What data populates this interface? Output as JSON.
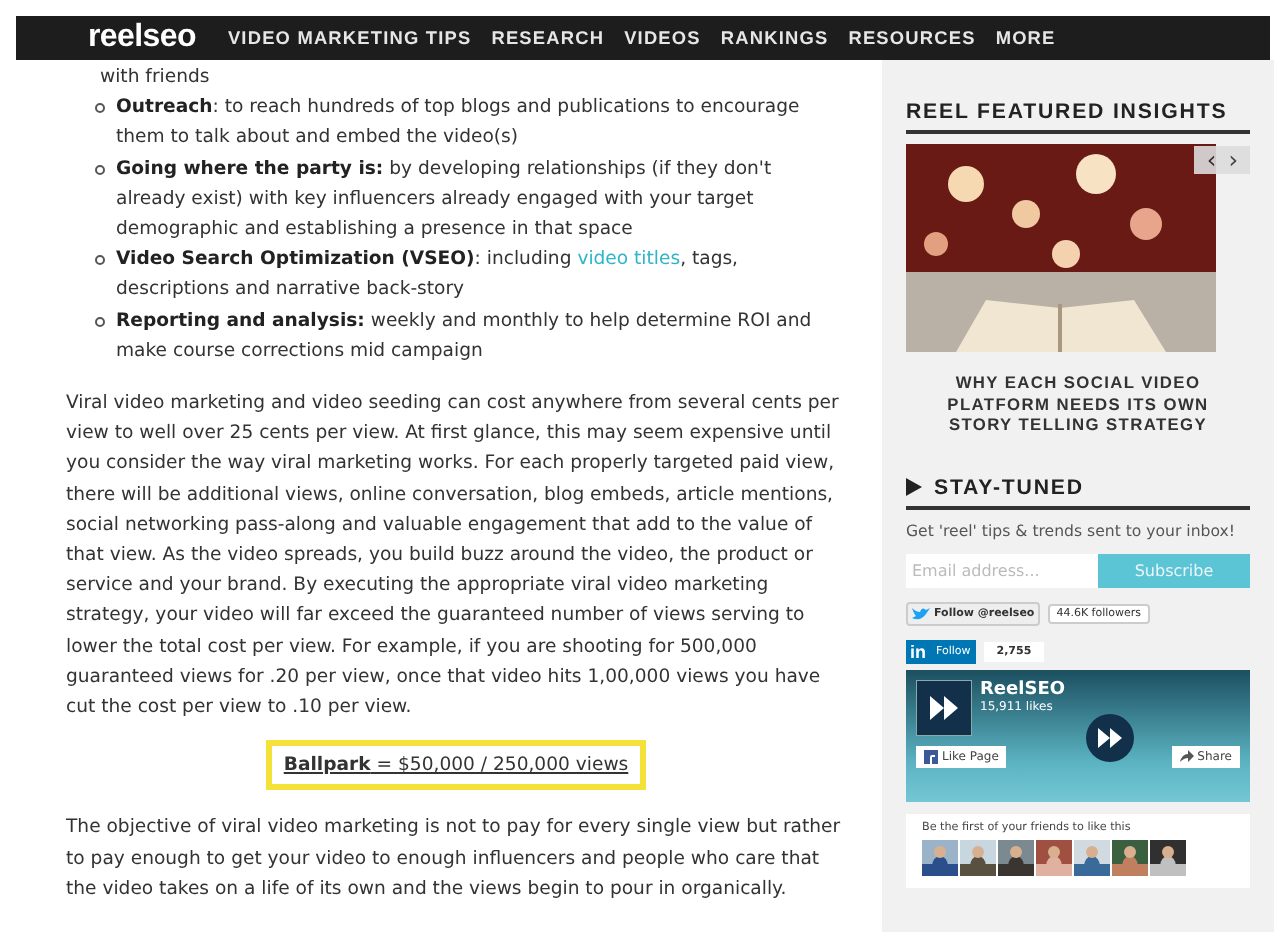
{
  "nav": {
    "logo": "reelseo",
    "items": [
      "VIDEO MARKETING TIPS",
      "RESEARCH",
      "VIDEOS",
      "RANKINGS",
      "RESOURCES",
      "MORE"
    ]
  },
  "article": {
    "bullets": [
      {
        "kind": "continuation",
        "text": "with friends"
      },
      {
        "kind": "bullet",
        "text": "**Outreach**: to reach hundreds of top blogs and publications to encourage them to talk about and embed the video(s)"
      },
      {
        "kind": "bullet",
        "text": "**Going where the party is:** by developing relationships (if they don't already exist) with key influencers already engaged with your target demographic and establishing a presence in that space"
      },
      {
        "kind": "bullet",
        "text": "**Video Search Optimization (VSEO)**: including ",
        "link": "video titles",
        "after": ", tags, descriptions and narrative back-story"
      },
      {
        "kind": "bullet",
        "text": "**Reporting and analysis:** weekly and monthly to help determine ROI and make course corrections mid campaign"
      }
    ],
    "paragraph_1": "Viral video marketing and video seeding can cost anywhere from several cents per view to well over 25 cents per view. At first glance, this may seem expensive until you consider the way viral marketing works. For each properly targeted paid view, there will be additional views, online conversation, blog embeds, article mentions, social networking pass-along and valuable engagement that add to the value of that view. As the video spreads, you build buzz around the video, the product or service and your brand. By executing the appropriate viral video marketing strategy, your video will far exceed the guaranteed number of views serving to lower the total cost per view. For example, if you are shooting for 500,000 guaranteed views for .20 per view, once that video hits 1,00,000 views you have cut the cost per view to .10 per view.",
    "callout": "**Ballpark** = $50,000 / 250,000 views",
    "paragraph_2": "The objective of viral video marketing is not to pay for every single view but rather to pay enough to get your video to enough influencers and people who care that the video takes on a life of its own and the views begin to pour in organically."
  },
  "sidebar": {
    "featured": {
      "heading": "REEL FEATURED INSIGHTS",
      "prev": "‹",
      "next": "›",
      "title": "WHY EACH SOCIAL VIDEO PLATFORM NEEDS ITS OWN STORY TELLING STRATEGY"
    },
    "stay_tuned": {
      "heading": "STAY-TUNED",
      "text": "Get 'reel' tips & trends sent to your inbox!",
      "email": {
        "placeholder": "Email address..."
      },
      "button": "Subscribe"
    },
    "twitter": {
      "button": "Follow @reelseo",
      "count": "44.6K followers"
    },
    "linkedin": {
      "logo": "in",
      "button": "Follow",
      "count": "2,755"
    },
    "facebook": {
      "name": "ReelSEO",
      "likes": "15,911 likes",
      "like_button": "Like Page",
      "share_button": "Share",
      "friends_text": "Be the first of your friends to like this"
    }
  }
}
